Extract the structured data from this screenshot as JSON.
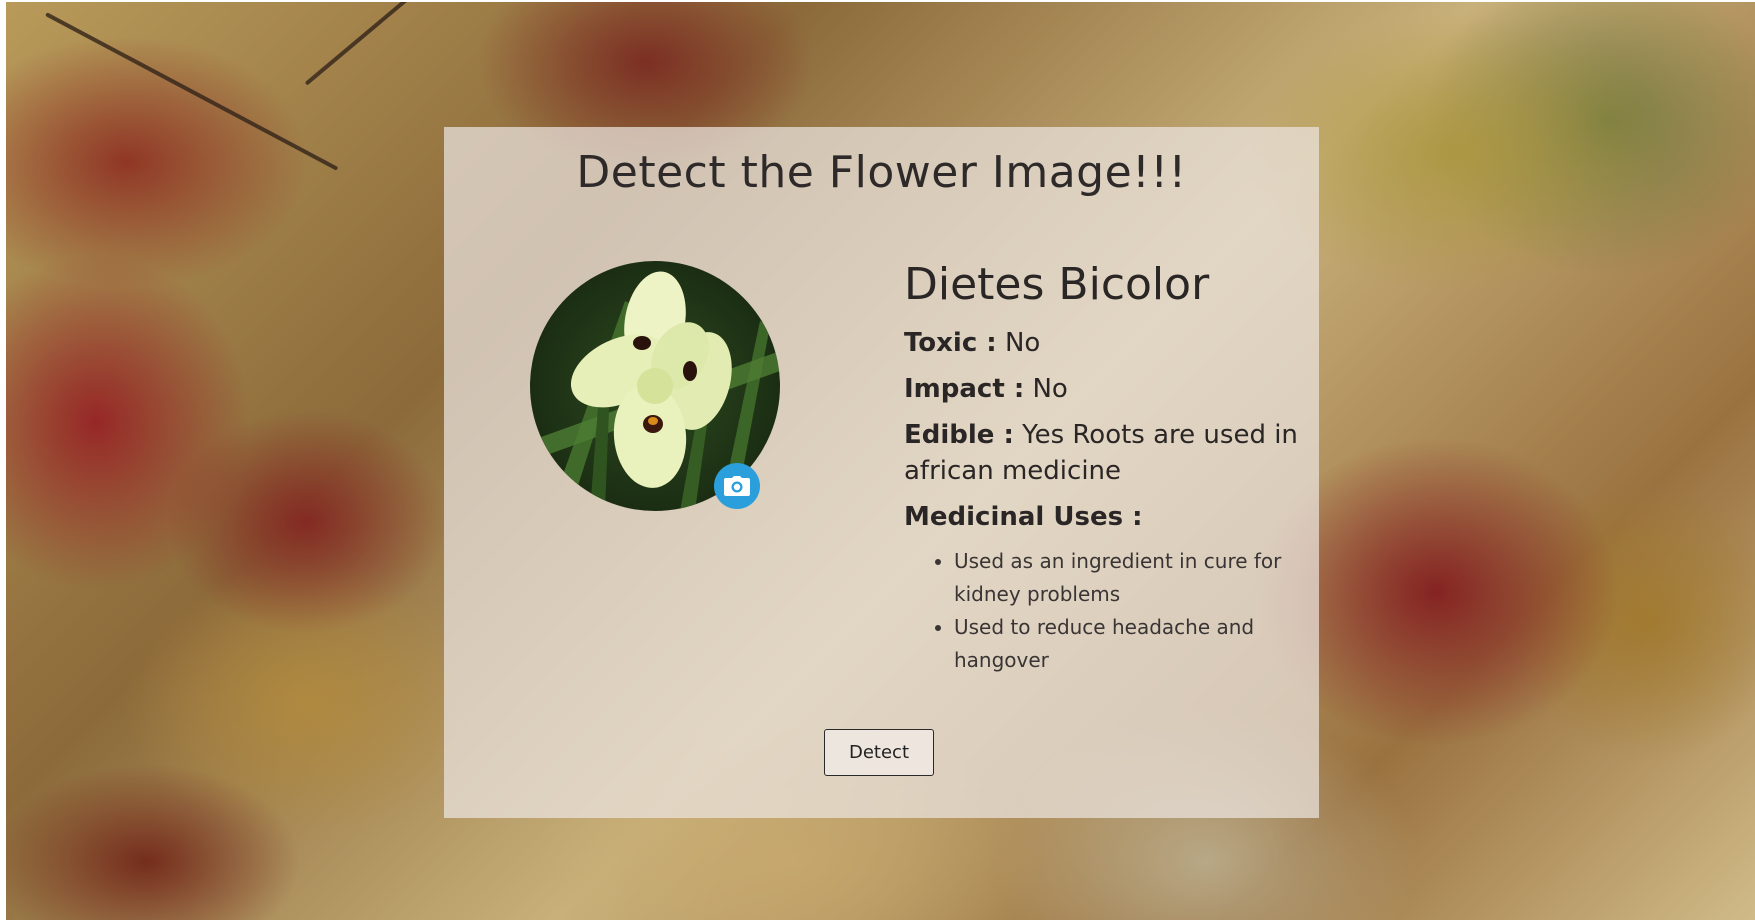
{
  "page": {
    "title": "Detect the Flower Image!!!"
  },
  "upload": {
    "camera_icon": "camera-icon",
    "camera_button_color": "#2b9fdc"
  },
  "result": {
    "name": "Dietes Bicolor",
    "toxic_label": "Toxic :",
    "toxic_value": "No",
    "impact_label": "Impact :",
    "impact_value": "No",
    "edible_label": "Edible :",
    "edible_value": "Yes Roots are used in african medicine",
    "medicinal_label": "Medicinal Uses :",
    "medicinal_uses": [
      "Used as an ingredient in cure for kidney problems",
      "Used to reduce headache and hangover"
    ]
  },
  "actions": {
    "detect_label": "Detect"
  }
}
